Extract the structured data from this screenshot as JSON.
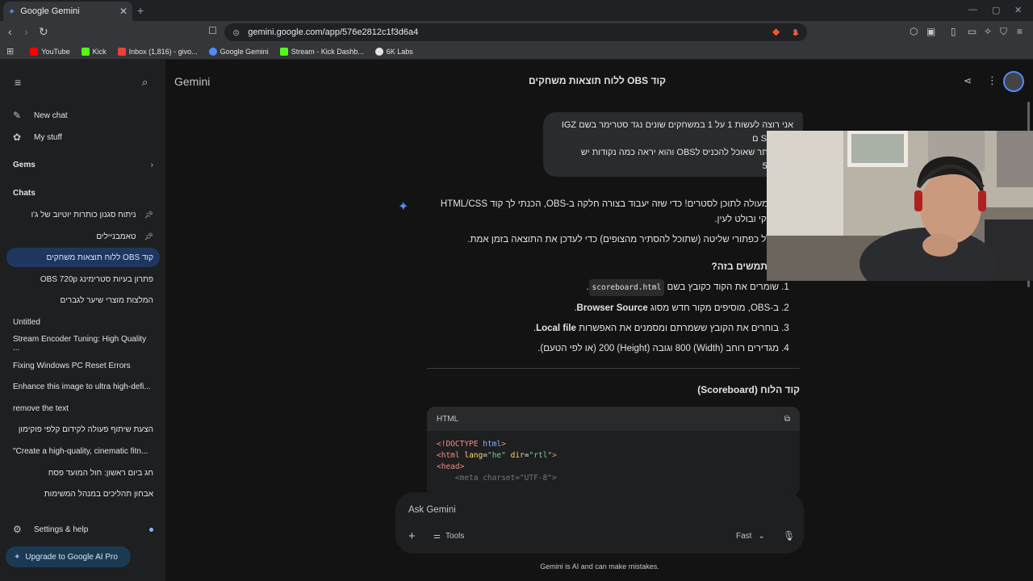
{
  "browser": {
    "tab_title": "Google Gemini",
    "tab_close": "✕",
    "new_tab": "+",
    "window_min": "—",
    "window_max": "▢",
    "window_close": "✕",
    "url": "gemini.google.com/app/576e2812c1f3d6a4",
    "bookmarks": [
      {
        "label": "YouTube",
        "color": "#ff0000"
      },
      {
        "label": "Kick",
        "color": "#53fc18"
      },
      {
        "label": "Inbox (1,816) - givo...",
        "color": "#ea4335"
      },
      {
        "label": "Google Gemini",
        "color": "#4c8df6"
      },
      {
        "label": "Stream - Kick Dashb...",
        "color": "#53fc18"
      },
      {
        "label": "6K Labs",
        "color": "#e3e3e3"
      }
    ]
  },
  "sidebar": {
    "new_chat": "New chat",
    "my_stuff": "My stuff",
    "gems": "Gems",
    "chats_header": "Chats",
    "chats": [
      {
        "label": "ניתוח סגנון כותרות יוטיוב של ג'ו",
        "pinned": true
      },
      {
        "label": "טאמבניילים",
        "pinned": true
      },
      {
        "label": "קוד OBS ללוח תוצאות משחקים",
        "active": true
      },
      {
        "label": "פתרון בעיות סטרימינג OBS 720p"
      },
      {
        "label": "המלצות מוצרי שיער לגברים"
      },
      {
        "label": "Untitled"
      },
      {
        "label": "Stream Encoder Tuning: High Quality ..."
      },
      {
        "label": "Fixing Windows PC Reset Errors"
      },
      {
        "label": "Enhance this image to ultra high-defi..."
      },
      {
        "label": "remove the text"
      },
      {
        "label": "הצעת שיתוף פעולה לקידום קלפי פוקימון"
      },
      {
        "label": "\"Create a high-quality, cinematic fitn..."
      },
      {
        "label": "חג ביום ראשון: חול המועד פסח"
      },
      {
        "label": "אבחון תהליכים במנהל המשימות"
      }
    ],
    "settings": "Settings & help",
    "upgrade": "Upgrade to Google AI Pro"
  },
  "main": {
    "brand": "Gemini",
    "chat_title": "קוד OBS ללוח תוצאות משחקים",
    "user_message": [
      "אני רוצה לעשות 1 על 1 במשחקים שונים נגד סטרימר בשם IGZ",
      "SENSEI ם",
      "קוד לאתר שאוכל להכניס לOBS והוא יראה כמה נקודות יש",
      "מ0 עד 5"
    ],
    "response": {
      "intro": "זה רעיון מעולה לתוכן לסטרים! כדי שזה יעבוד בצורה חלקה ב-OBS, הכנתי לך קוד HTML/CSS מעוצב, נקי ובולט לעין.",
      "intro2": "הקוד כולל כפתורי שליטה (שתוכל להסתיר מהצופים) כדי לעדכן את התוצאה בזמן אמת.",
      "howto_title": "איך משתמשים בזה?",
      "steps": [
        {
          "pre": "שומרים את הקוד כקובץ בשם",
          "code": "scoreboard.html",
          "post": "."
        },
        {
          "pre": "ב-OBS, מוסיפים מקור חדש מסוג ",
          "bold": "Browser Source",
          "post": "."
        },
        {
          "pre": "בוחרים את הקובץ ששמרתם ומסמנים את האפשרות ",
          "bold": "Local file",
          "post": "."
        },
        {
          "pre": "מגדירים רוחב (Width) 800 וגובה (Height) 200 (או לפי הטעם).",
          "post": ""
        }
      ],
      "code_title": "קוד הלוח (Scoreboard)",
      "code_lang": "HTML"
    },
    "input_placeholder": "Ask Gemini",
    "tools": "Tools",
    "mode": "Fast",
    "disclaimer": "Gemini is AI and can make mistakes."
  }
}
